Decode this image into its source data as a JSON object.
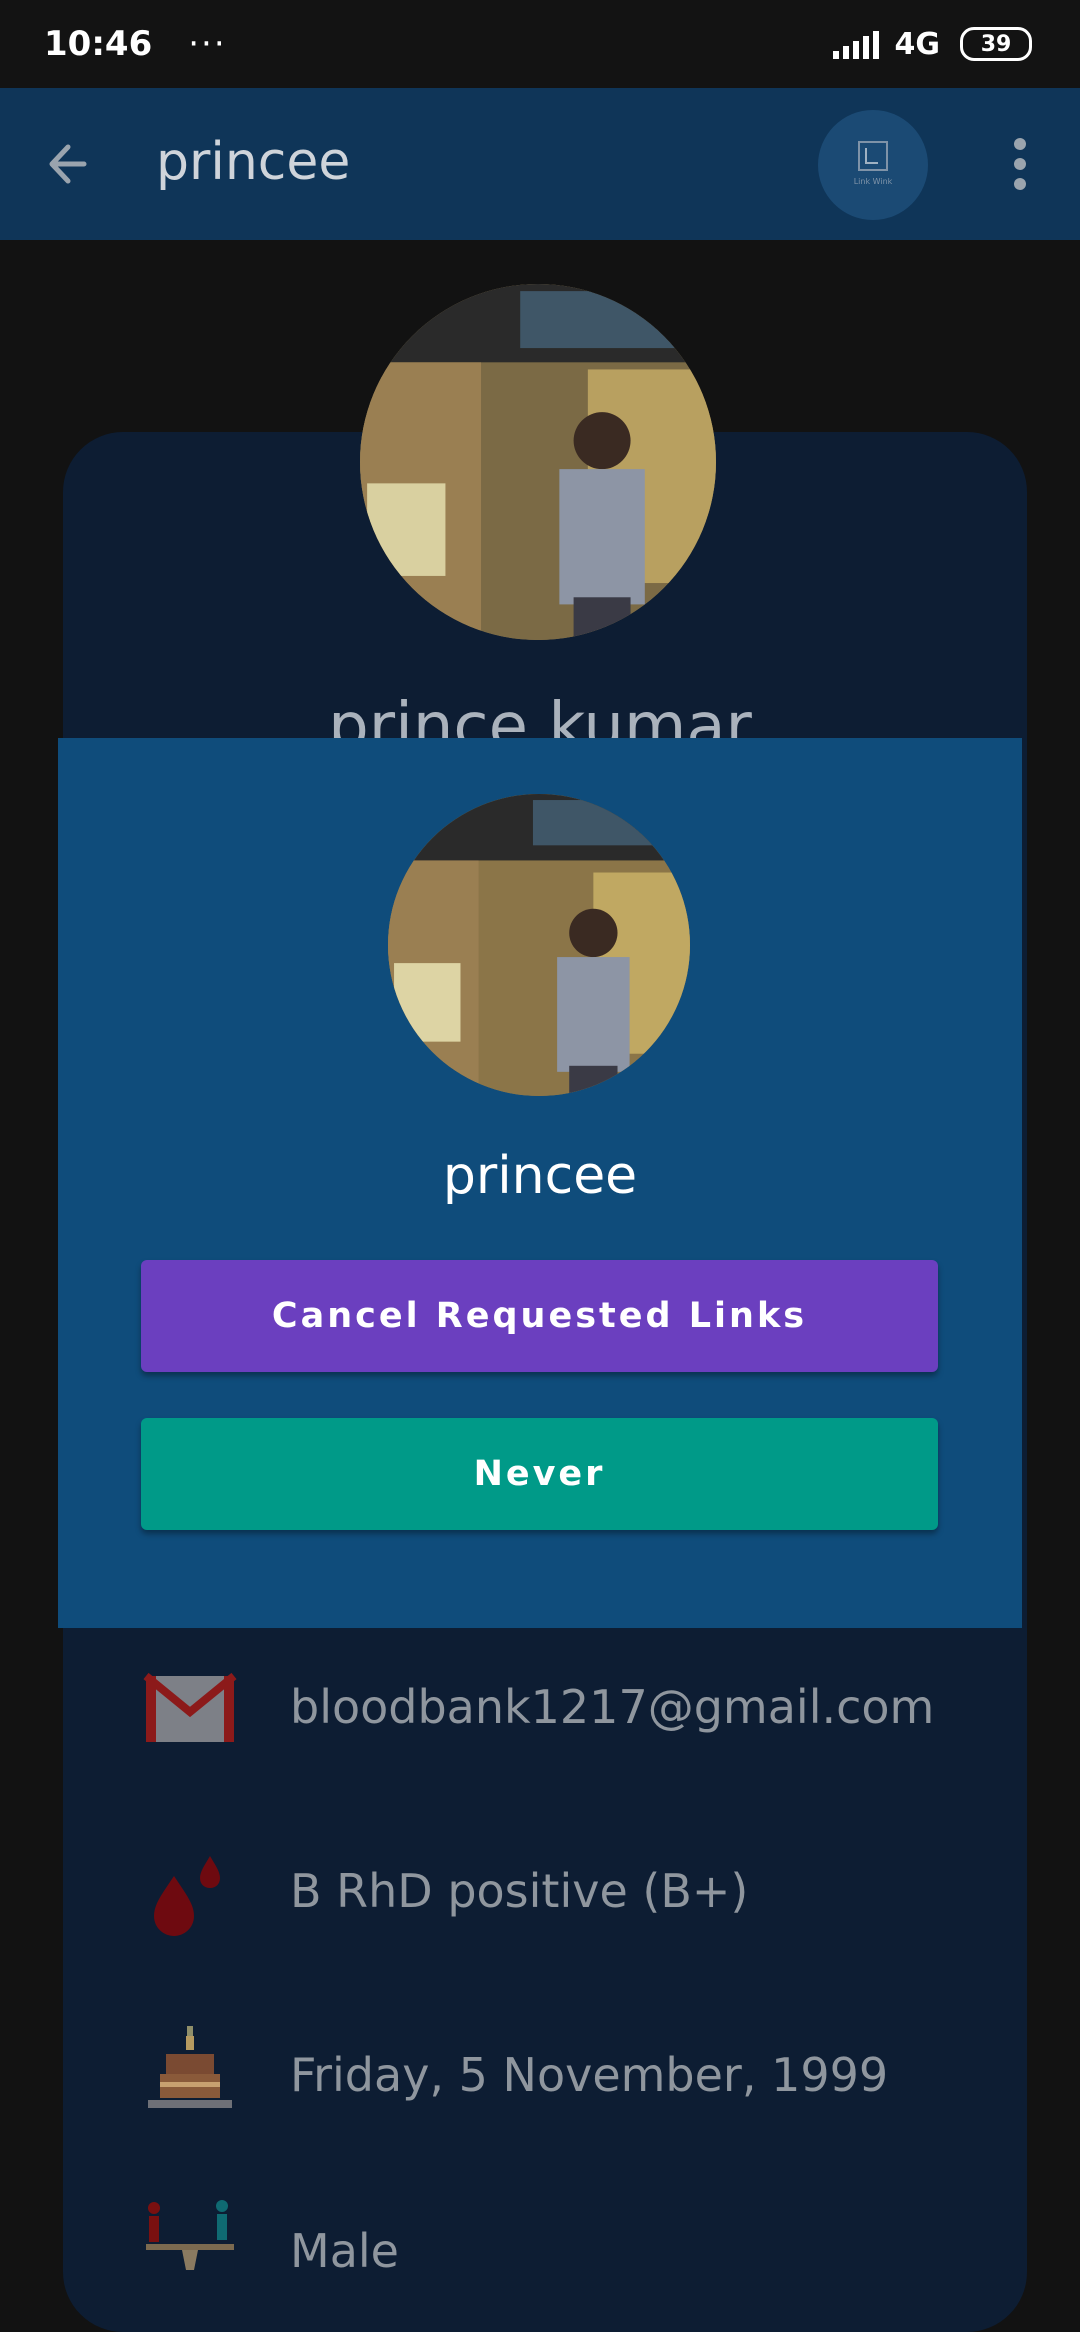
{
  "status_bar": {
    "time": "10:46",
    "dots": "···",
    "network": "4G",
    "battery": "39"
  },
  "app_bar": {
    "title": "princee",
    "logo_text": "Link Wink"
  },
  "profile": {
    "name": "prince kumar",
    "email": "bloodbank1217@gmail.com",
    "blood_group": "B RhD positive (B+)",
    "birthday": "Friday, 5 November, 1999",
    "gender": "Male"
  },
  "dialog": {
    "name": "princee",
    "cancel_label": "Cancel Requested Links",
    "never_label": "Never"
  },
  "colors": {
    "app_bar": "#0f3558",
    "dialog": "#0f4c7b",
    "cancel_button": "#6b3fbf",
    "never_button": "#009a88"
  }
}
